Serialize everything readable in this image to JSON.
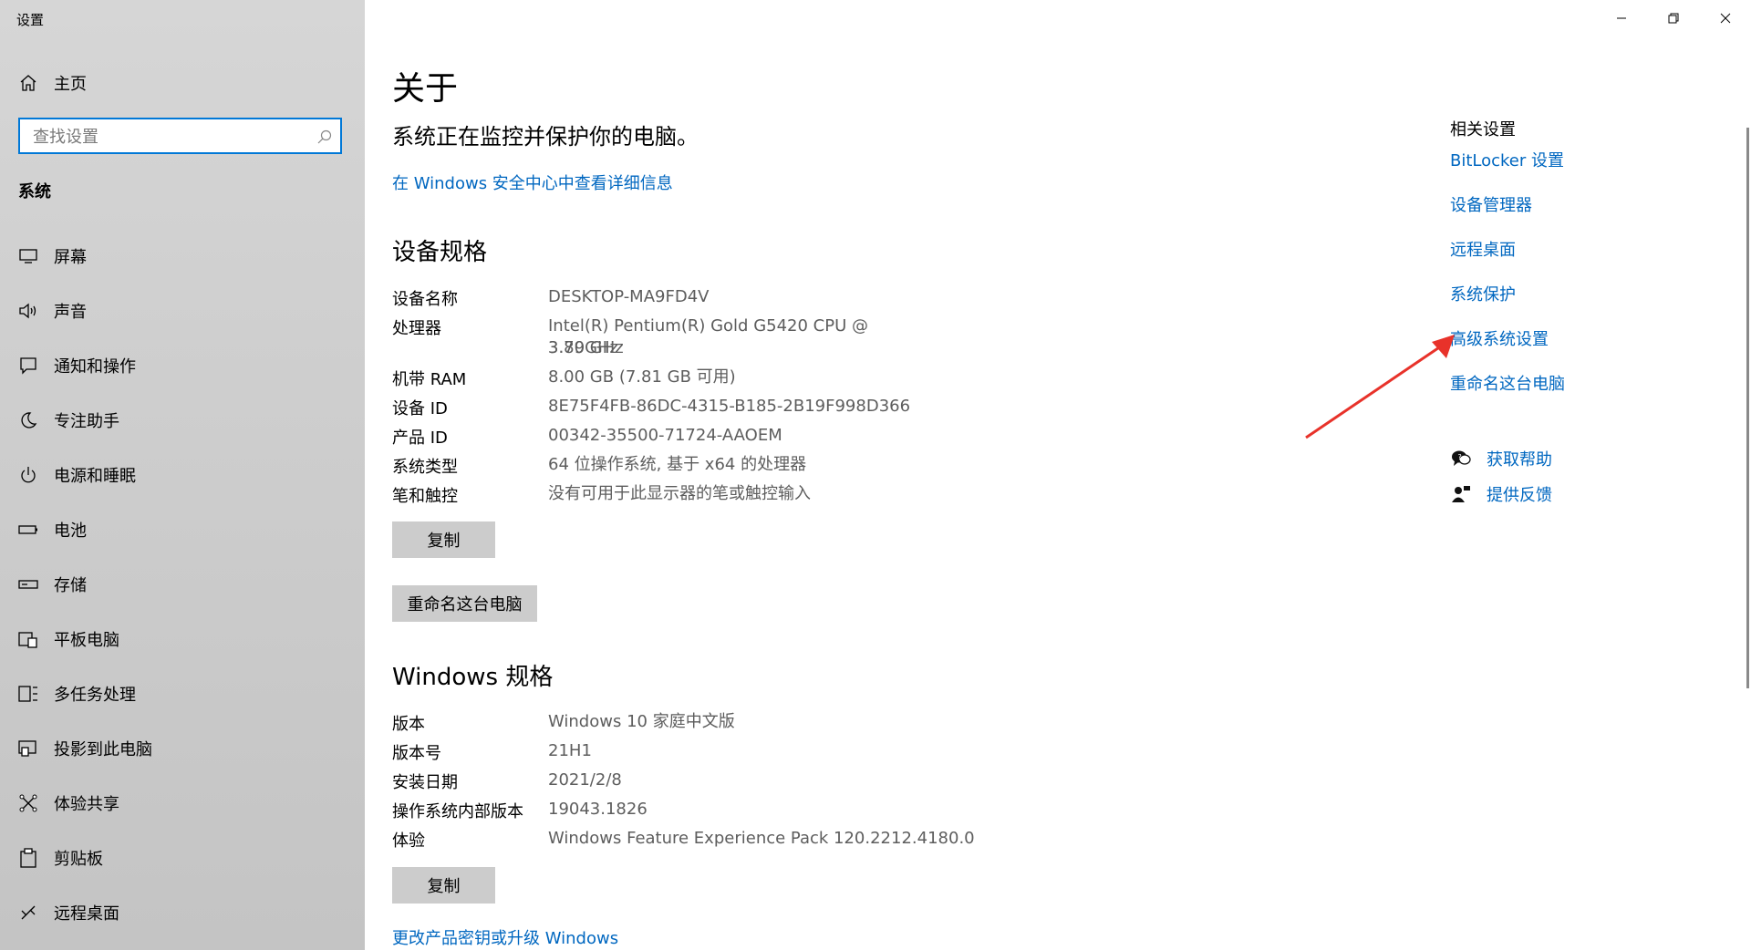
{
  "window": {
    "title": "设置",
    "controls": [
      "minimize",
      "restore",
      "close"
    ]
  },
  "sidebar": {
    "home_label": "主页",
    "search": {
      "placeholder": "查找设置",
      "value": ""
    },
    "section_label": "系统",
    "items": [
      {
        "label": "屏幕",
        "icon": "monitor-icon"
      },
      {
        "label": "声音",
        "icon": "speaker-icon"
      },
      {
        "label": "通知和操作",
        "icon": "notification-icon"
      },
      {
        "label": "专注助手",
        "icon": "moon-icon"
      },
      {
        "label": "电源和睡眠",
        "icon": "power-icon"
      },
      {
        "label": "电池",
        "icon": "battery-icon"
      },
      {
        "label": "存储",
        "icon": "storage-icon"
      },
      {
        "label": "平板电脑",
        "icon": "tablet-icon"
      },
      {
        "label": "多任务处理",
        "icon": "multitask-icon"
      },
      {
        "label": "投影到此电脑",
        "icon": "project-icon"
      },
      {
        "label": "体验共享",
        "icon": "share-icon"
      },
      {
        "label": "剪贴板",
        "icon": "clipboard-icon"
      },
      {
        "label": "远程桌面",
        "icon": "remote-icon"
      }
    ]
  },
  "main": {
    "title": "关于",
    "protect_text": "系统正在监控并保护你的电脑。",
    "security_link": "在 Windows 安全中心中查看详细信息",
    "device_specs": {
      "heading": "设备规格",
      "rows": [
        {
          "key": "设备名称",
          "value": "DESKTOP-MA9FD4V"
        },
        {
          "key": "处理器",
          "value": "Intel(R) Pentium(R) Gold G5420 CPU @ 3.80GHz",
          "value2": "3.79 GHz"
        },
        {
          "key": "机带 RAM",
          "value": "8.00 GB (7.81 GB 可用)"
        },
        {
          "key": "设备 ID",
          "value": "8E75F4FB-86DC-4315-B185-2B19F998D366"
        },
        {
          "key": "产品 ID",
          "value": "00342-35500-71724-AAOEM"
        },
        {
          "key": "系统类型",
          "value": "64 位操作系统, 基于 x64 的处理器"
        },
        {
          "key": "笔和触控",
          "value": "没有可用于此显示器的笔或触控输入"
        }
      ],
      "copy_button": "复制",
      "rename_button": "重命名这台电脑"
    },
    "windows_specs": {
      "heading": "Windows 规格",
      "rows": [
        {
          "key": "版本",
          "value": "Windows 10 家庭中文版"
        },
        {
          "key": "版本号",
          "value": "21H1"
        },
        {
          "key": "安装日期",
          "value": "2021/2/8"
        },
        {
          "key": "操作系统内部版本",
          "value": "19043.1826"
        },
        {
          "key": "体验",
          "value": "Windows Feature Experience Pack 120.2212.4180.0"
        }
      ],
      "copy_button": "复制"
    },
    "product_key_link": "更改产品密钥或升级 Windows"
  },
  "related": {
    "title": "相关设置",
    "links": [
      "BitLocker 设置",
      "设备管理器",
      "远程桌面",
      "系统保护",
      "高级系统设置",
      "重命名这台电脑"
    ],
    "help": [
      {
        "label": "获取帮助",
        "icon": "help-chat-icon"
      },
      {
        "label": "提供反馈",
        "icon": "feedback-icon"
      }
    ]
  },
  "annotation": {
    "arrow_color": "#e8322a"
  },
  "colors": {
    "accent": "#0067c0",
    "focus_border": "#0078d7",
    "button_bg": "#cccccc"
  }
}
